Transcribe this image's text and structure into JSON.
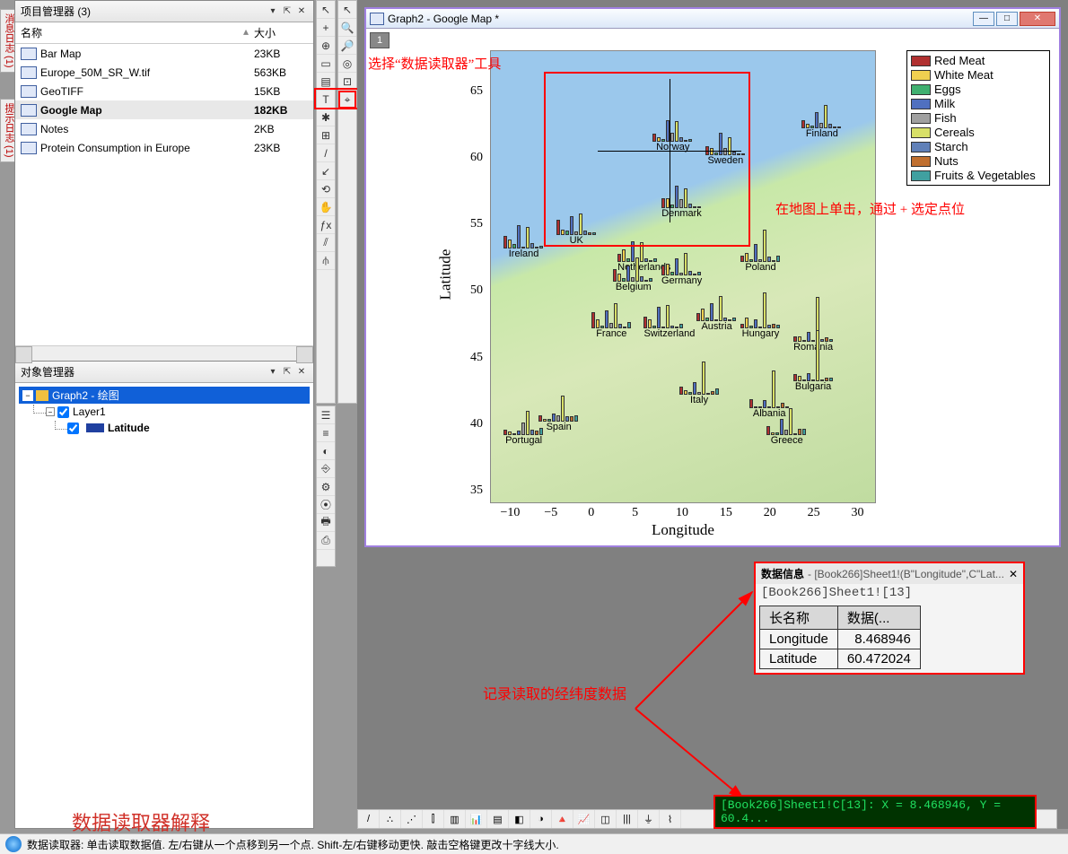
{
  "side_tabs": {
    "t1": "消息日志 (1)",
    "t2": "提示日志 (1)"
  },
  "project_panel": {
    "title": "项目管理器 (3)",
    "col_name": "名称",
    "col_size": "大小",
    "items": [
      {
        "name": "Bar Map",
        "size": "23KB",
        "selected": false
      },
      {
        "name": "Europe_50M_SR_W.tif",
        "size": "563KB",
        "selected": false
      },
      {
        "name": "GeoTIFF",
        "size": "15KB",
        "selected": false
      },
      {
        "name": "Google Map",
        "size": "182KB",
        "selected": true
      },
      {
        "name": "Notes",
        "size": "2KB",
        "selected": false
      },
      {
        "name": "Protein Consumption in Europe",
        "size": "23KB",
        "selected": false
      }
    ]
  },
  "object_panel": {
    "title": "对象管理器",
    "root": "Graph2 - 绘图",
    "layer": "Layer1",
    "leaf": "Latitude"
  },
  "graph_window": {
    "title": "Graph2 - Google Map *",
    "layer_tab": "1"
  },
  "chart_data": {
    "type": "bar-on-map",
    "xlabel": "Longitude",
    "ylabel": "Latitude",
    "xlim": [
      -12,
      32
    ],
    "ylim": [
      34,
      68
    ],
    "xticks": [
      -10,
      -5,
      0,
      5,
      10,
      15,
      20,
      25,
      30
    ],
    "yticks": [
      35,
      40,
      45,
      50,
      55,
      60,
      65
    ],
    "legend": [
      "Red Meat",
      "White Meat",
      "Eggs",
      "Milk",
      "Fish",
      "Cereals",
      "Starch",
      "Nuts",
      "Fruits & Vegetables"
    ],
    "colors": [
      "#b03030",
      "#f0d050",
      "#40b070",
      "#5070c0",
      "#a0a0a0",
      "#d8e068",
      "#6080b8",
      "#c07030",
      "#40a0a0"
    ],
    "crosshair": {
      "x": 8.468946,
      "y": 60.472024
    },
    "countries": [
      {
        "name": "Finland",
        "lon": 26,
        "lat": 62,
        "v": [
          9,
          5,
          3,
          18,
          6,
          26,
          5,
          1,
          1
        ]
      },
      {
        "name": "Sweden",
        "lon": 15,
        "lat": 60,
        "v": [
          10,
          8,
          3,
          25,
          8,
          20,
          4,
          1,
          2
        ]
      },
      {
        "name": "Norway",
        "lon": 9,
        "lat": 61,
        "v": [
          9,
          5,
          3,
          24,
          10,
          23,
          5,
          2,
          3
        ]
      },
      {
        "name": "Denmark",
        "lon": 10,
        "lat": 56,
        "v": [
          11,
          11,
          4,
          25,
          10,
          22,
          5,
          2,
          2
        ]
      },
      {
        "name": "UK",
        "lon": -2,
        "lat": 54,
        "v": [
          17,
          6,
          5,
          21,
          4,
          24,
          5,
          3,
          3
        ]
      },
      {
        "name": "Ireland",
        "lon": -8,
        "lat": 53,
        "v": [
          14,
          10,
          5,
          26,
          2,
          24,
          6,
          2,
          3
        ]
      },
      {
        "name": "Netherlands",
        "lon": 5,
        "lat": 52,
        "v": [
          9,
          14,
          4,
          23,
          3,
          22,
          4,
          2,
          4
        ]
      },
      {
        "name": "Belgium",
        "lon": 4.5,
        "lat": 50.5,
        "v": [
          14,
          9,
          4,
          18,
          5,
          27,
          6,
          2,
          4
        ]
      },
      {
        "name": "Germany",
        "lon": 10,
        "lat": 51,
        "v": [
          11,
          13,
          4,
          19,
          3,
          25,
          5,
          2,
          4
        ]
      },
      {
        "name": "Poland",
        "lon": 19,
        "lat": 52,
        "v": [
          7,
          10,
          3,
          20,
          3,
          36,
          6,
          2,
          7
        ]
      },
      {
        "name": "France",
        "lon": 2,
        "lat": 47,
        "v": [
          18,
          10,
          3,
          20,
          6,
          28,
          5,
          2,
          7
        ]
      },
      {
        "name": "Switzerland",
        "lon": 8,
        "lat": 47,
        "v": [
          13,
          10,
          3,
          24,
          2,
          26,
          3,
          2,
          5
        ]
      },
      {
        "name": "Austria",
        "lon": 14,
        "lat": 47.5,
        "v": [
          9,
          14,
          4,
          20,
          2,
          28,
          4,
          1,
          4
        ]
      },
      {
        "name": "Hungary",
        "lon": 19,
        "lat": 47,
        "v": [
          5,
          12,
          3,
          10,
          0,
          40,
          4,
          5,
          4
        ]
      },
      {
        "name": "Romania",
        "lon": 25,
        "lat": 46,
        "v": [
          6,
          6,
          2,
          11,
          1,
          50,
          3,
          5,
          3
        ]
      },
      {
        "name": "Bulgaria",
        "lon": 25,
        "lat": 43,
        "v": [
          8,
          6,
          2,
          9,
          1,
          57,
          1,
          4,
          4
        ]
      },
      {
        "name": "Italy",
        "lon": 12,
        "lat": 42,
        "v": [
          9,
          5,
          3,
          14,
          3,
          37,
          2,
          4,
          7
        ]
      },
      {
        "name": "Albania",
        "lon": 20,
        "lat": 41,
        "v": [
          10,
          1,
          1,
          9,
          0,
          42,
          1,
          6,
          2
        ]
      },
      {
        "name": "Greece",
        "lon": 22,
        "lat": 39,
        "v": [
          10,
          3,
          3,
          18,
          6,
          30,
          2,
          7,
          7
        ]
      },
      {
        "name": "Spain",
        "lon": -4,
        "lat": 40,
        "v": [
          7,
          3,
          3,
          9,
          7,
          29,
          6,
          6,
          7
        ]
      },
      {
        "name": "Portugal",
        "lon": -8,
        "lat": 39,
        "v": [
          6,
          4,
          1,
          5,
          14,
          27,
          6,
          5,
          8
        ]
      }
    ]
  },
  "annotations": {
    "tool_hint": "选择“数据读取器”工具",
    "click_hint": "在地图上单击，通过 + 选定点位",
    "record_hint": "记录读取的经纬度数据",
    "explain": "数据读取器解释"
  },
  "data_info": {
    "title": "数据信息",
    "title_sub": "- [Book266]Sheet1!(B\"Longitude\",C\"Lat...",
    "ref": "[Book266]Sheet1![13]",
    "head1": "长名称",
    "head2": "数据(...",
    "rows": [
      {
        "k": "Longitude",
        "v": "8.468946"
      },
      {
        "k": "Latitude",
        "v": "60.472024"
      }
    ]
  },
  "status_coord": "[Book266]Sheet1!C[13]:  X = 8.468946, Y = 60.4...",
  "statusbar": "数据读取器: 单击读取数据值. 左/右键从一个点移到另一个点. Shift-左/右键移动更快. 敲击空格键更改十字线大小.",
  "vtool_icons": [
    "↖",
    "+",
    "⊕",
    "▭",
    "▤",
    "T",
    "✱",
    "⊞",
    "/",
    "↙",
    "⟲",
    "✋",
    "ƒx",
    "⫽",
    "⫛"
  ],
  "vtool2_icons": [
    "↖",
    "🔍",
    "🔎",
    "◎",
    "⊡",
    "⌖"
  ],
  "vtool3_icons": [
    "☰",
    "≡",
    "◐",
    "⎆",
    "⚙",
    "⦿",
    "🖶",
    "⎙"
  ],
  "btm_icons": [
    "/",
    "∴",
    "⋰",
    "⫿",
    "▥",
    "📊",
    "▤",
    "◧",
    "◑",
    "🔺",
    "📈",
    "◫",
    "|||",
    "⏚",
    "⌇"
  ]
}
